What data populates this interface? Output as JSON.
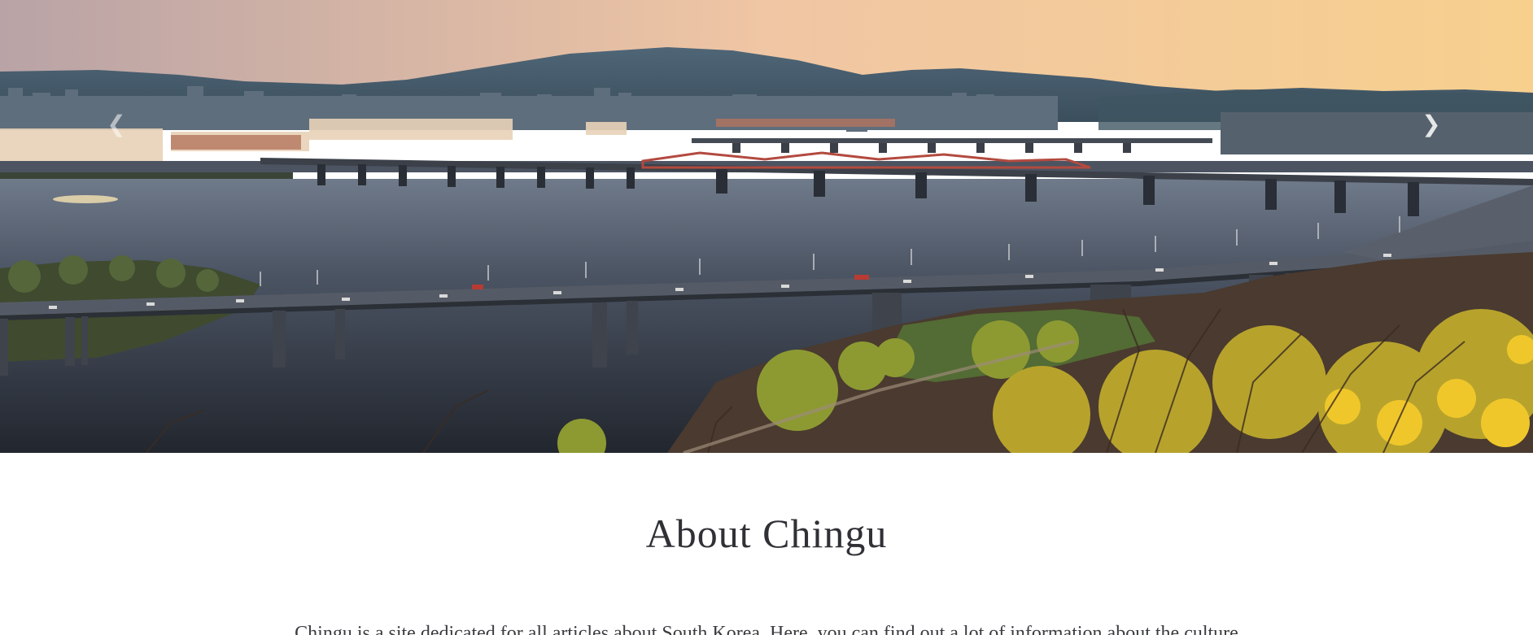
{
  "carousel": {
    "prev_icon": "chevron-left-icon",
    "prev_glyph": "❮",
    "next_icon": "chevron-right-icon",
    "next_glyph": "❯",
    "slide_image": "Han River bridges at sunset with Seoul skyline and mountains"
  },
  "about": {
    "title": "About Chingu",
    "intro": "Chingu is a site dedicated for all articles about South Korea. Here, you can find out a lot of information about the culture"
  },
  "colors": {
    "sky_top": "#c9a89e",
    "sky_bottom": "#f6c98a",
    "water": "#3e4654",
    "title_text": "#2f3136"
  }
}
